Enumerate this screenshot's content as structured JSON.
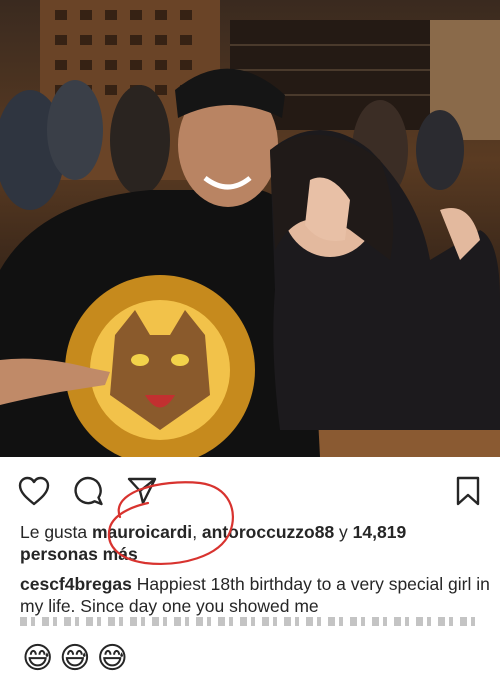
{
  "post": {
    "photo": {
      "description_icon": "photo-icon"
    },
    "actions": {
      "like_icon": "heart-icon",
      "comment_icon": "comment-icon",
      "share_icon": "send-icon",
      "save_icon": "bookmark-icon"
    },
    "likes": {
      "prefix": "Le gusta ",
      "user1": "mauroicardi",
      "sep": ", ",
      "user2": "antoroccuzzo88",
      "mid": " y ",
      "count": "14,819",
      "line2": "personas más"
    },
    "caption": {
      "username": "cescf4bregas",
      "text": " Happiest 18th birthday to a very special girl in my life. Since day one you showed me"
    }
  },
  "comment_emojis": [
    "😅",
    "😅",
    "😅"
  ],
  "colors": {
    "text": "#262626",
    "annotation_red": "#d8332f",
    "background": "#ffffff"
  }
}
